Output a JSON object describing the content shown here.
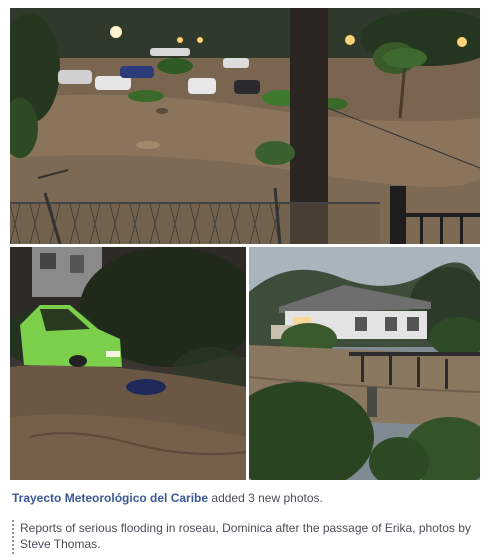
{
  "post": {
    "author": "Trayecto Meteorológico del Caribe",
    "action": "added 3 new photos.",
    "description": "Reports of serious flooding in roseau, Dominica after the passage of Erika, photos by Steve Thomas."
  },
  "photos": [
    {
      "icon": "flooded-street-photo"
    },
    {
      "icon": "flooded-car-photo"
    },
    {
      "icon": "flooded-house-photo"
    }
  ]
}
